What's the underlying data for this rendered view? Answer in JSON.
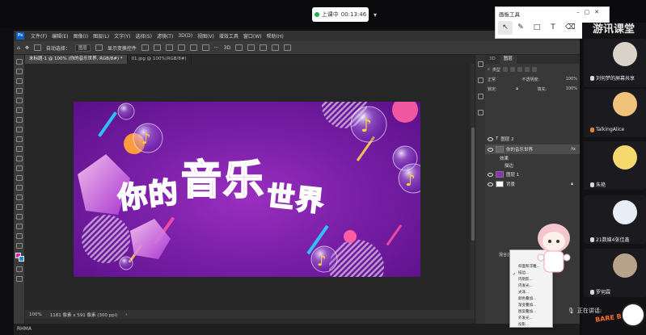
{
  "live_bar": {
    "status": "上课中",
    "time": "00:13:46"
  },
  "photoshop": {
    "menu": [
      "文件(F)",
      "编辑(E)",
      "图像(I)",
      "图层(L)",
      "文字(Y)",
      "选择(S)",
      "滤镜(T)",
      "3D(D)",
      "视图(V)",
      "增效工具",
      "窗口(W)",
      "帮助(H)"
    ],
    "options": {
      "auto_select": "自动选择：",
      "target": "图层",
      "show_transform": "显示变换控件"
    },
    "doc_tabs": [
      {
        "label": "未标题-1 @ 100% (你的音乐世界, RGB/8#) *",
        "active": true
      },
      {
        "label": "01.jpg @ 100%(RGB/8#)",
        "active": false
      }
    ],
    "artwork": {
      "title_part1": "你的",
      "title_part2": "音乐",
      "title_part3": "世界"
    },
    "status": {
      "zoom": "100%",
      "size": "1181 像素 x 591 像素 (300 ppi)"
    },
    "layers_panel": {
      "tabs": [
        "3D",
        "图层"
      ],
      "filter": "类型",
      "blend_mode": "正常",
      "opacity_label": "不透明度:",
      "opacity_value": "100%",
      "lock_label": "锁定:",
      "fill_label": "填充:",
      "fill_value": "100%",
      "layers": [
        {
          "name": "图层 2",
          "selected": false,
          "type": "text"
        },
        {
          "name": "你的音乐世界",
          "selected": true,
          "type": "text",
          "fx": "fx"
        },
        {
          "name": "效果",
          "selected": false,
          "type": "effect"
        },
        {
          "name": "描边",
          "selected": false,
          "type": "effect"
        },
        {
          "name": "图层 1",
          "selected": false,
          "type": "image"
        },
        {
          "name": "背景",
          "selected": false,
          "type": "bg"
        }
      ]
    },
    "context_menu": {
      "header": "混合选项...",
      "items": [
        "斜面和浮雕...",
        "描边...",
        "内阴影...",
        "内发光...",
        "光泽...",
        "颜色叠加...",
        "渐变叠加...",
        "图案叠加...",
        "外发光...",
        "投影..."
      ],
      "checked_index": 1
    },
    "bottom_left": "RHMA"
  },
  "draw_tools": {
    "title": "画板工具",
    "icons": [
      "cursor-icon",
      "pen-icon",
      "rectangle-icon",
      "text-icon",
      "eraser-icon",
      "undo-icon",
      "redo-icon"
    ]
  },
  "classroom": {
    "brand": "游讯课堂",
    "participants": [
      {
        "name": "刘何梦的屏幕共享",
        "mic_on": false
      },
      {
        "name": "TalkingAlice",
        "mic_on": true
      },
      {
        "name": "朱艳",
        "mic_on": false
      },
      {
        "name": "21数媒4张佳鑫",
        "mic_on": false
      },
      {
        "name": "罗何霖",
        "mic_on": false
      }
    ],
    "speaking": "正在讲话:",
    "logo": "BARE BEARS"
  },
  "colors": {
    "accent_magenta": "#e01cc4",
    "accent_blue": "#1b8ad9",
    "artwork_purple": "#7a1fa8"
  }
}
